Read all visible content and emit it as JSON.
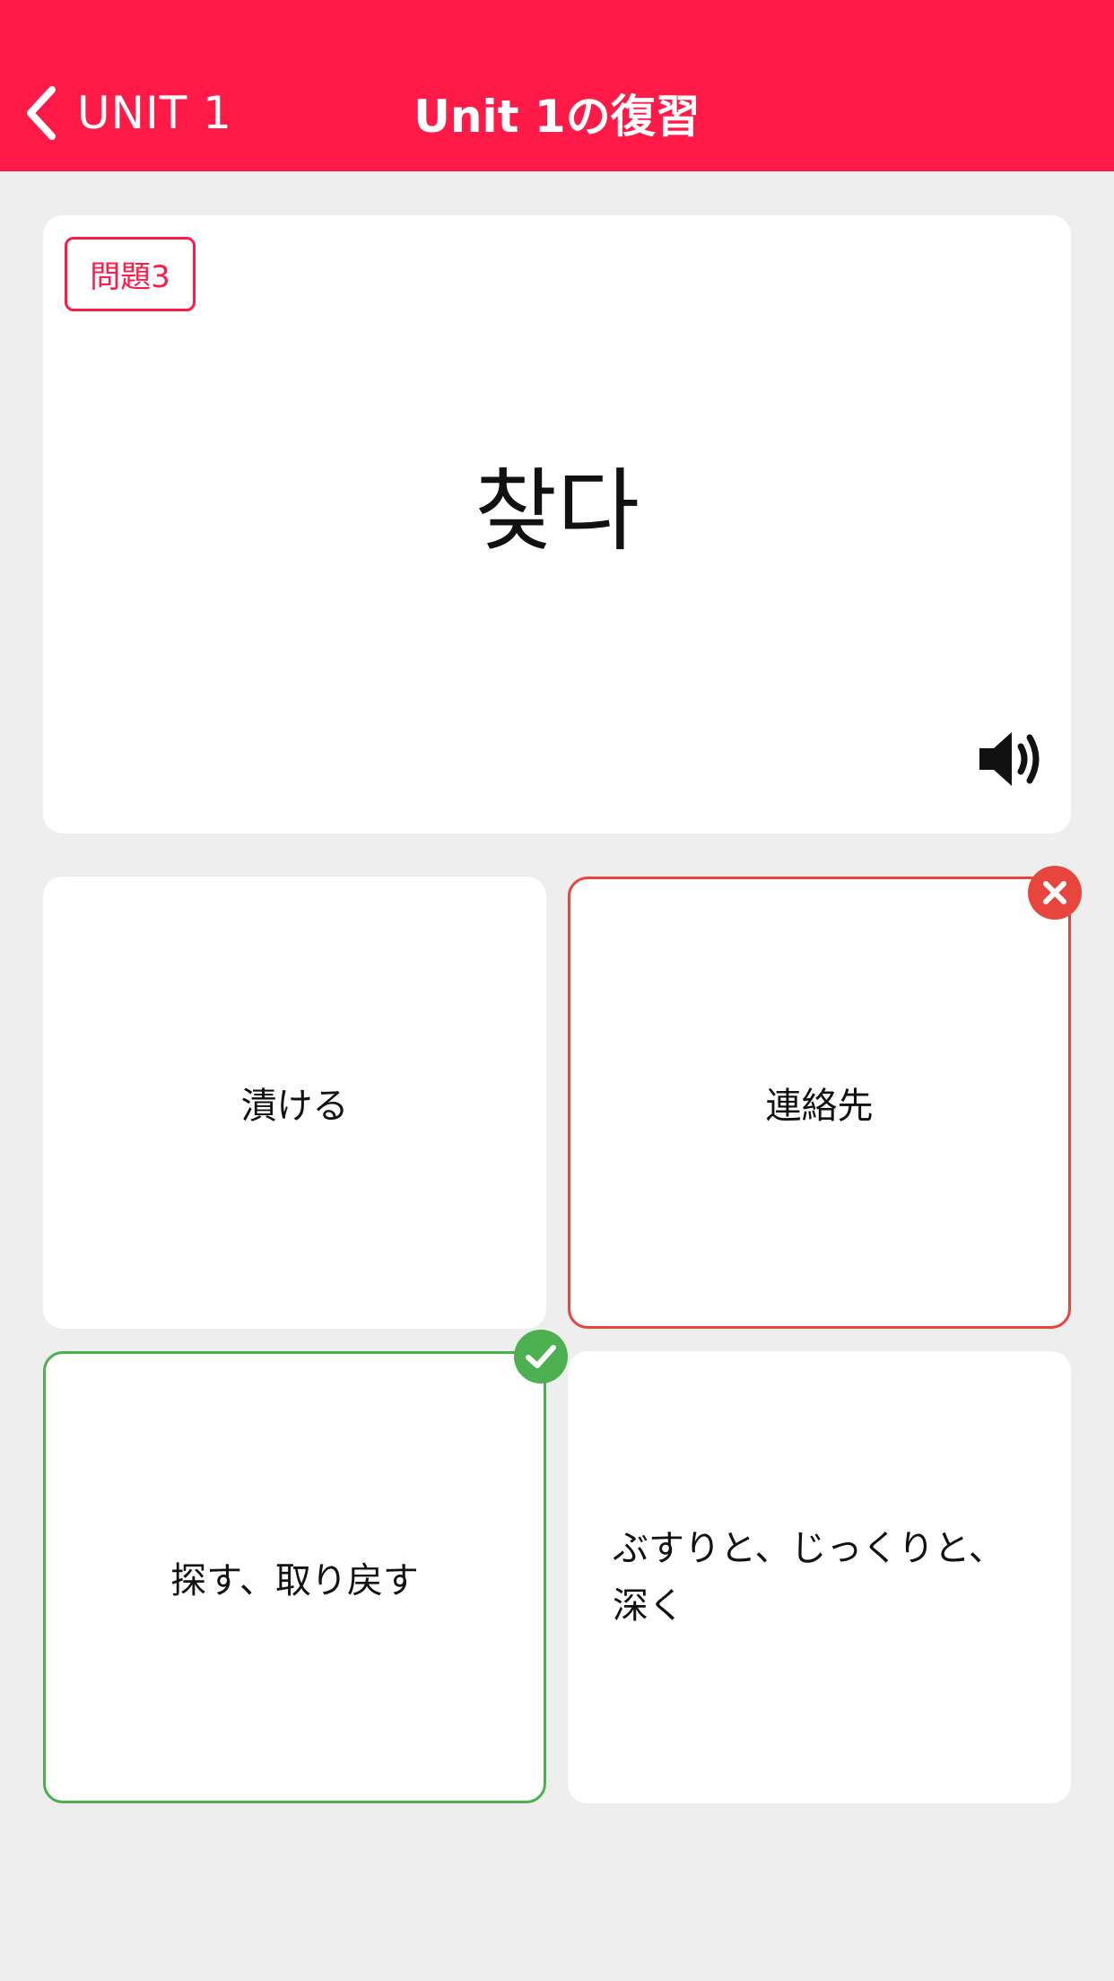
{
  "header": {
    "back_label": "UNIT 1",
    "title": "Unit 1の復習"
  },
  "question": {
    "badge": "問題3",
    "word": "찾다",
    "audio_icon": "speaker-icon"
  },
  "choices": [
    {
      "text": "漬ける",
      "state": "default"
    },
    {
      "text": "連絡先",
      "state": "wrong"
    },
    {
      "text": "探す、取り戻す",
      "state": "correct"
    },
    {
      "text": "ぶすりと、じっくりと、深く",
      "state": "default"
    }
  ],
  "colors": {
    "brand": "#ff1a47",
    "wrong": "#e8453c",
    "correct": "#4caf50",
    "background": "#eeeeee"
  }
}
